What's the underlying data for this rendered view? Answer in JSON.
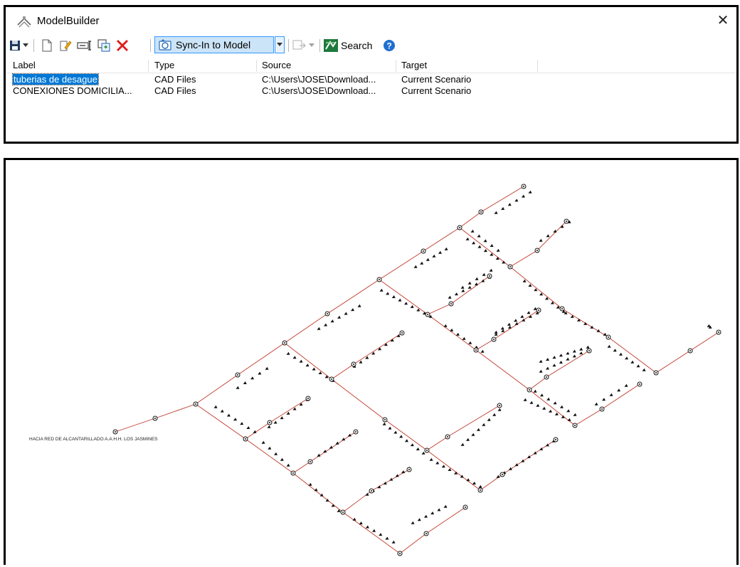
{
  "window": {
    "title": "ModelBuilder",
    "close_glyph": "✕"
  },
  "toolbar": {
    "sync_label": "Sync-In to Model",
    "search_label": "Search",
    "icons": [
      "save-icon",
      "dropdown-icon",
      "new-icon",
      "edit-icon",
      "rename-icon",
      "duplicate-icon",
      "delete-icon",
      "sync-icon",
      "build-icon",
      "search-icon",
      "help-icon"
    ]
  },
  "table": {
    "columns": [
      "Label",
      "Type",
      "Source",
      "Target"
    ],
    "rows": [
      {
        "label": "tuberias de desague",
        "type": "CAD Files",
        "source": "C:\\Users\\JOSE\\Download...",
        "target": "Current Scenario",
        "selected": true
      },
      {
        "label": "CONEXIONES DOMICILIA...",
        "type": "CAD Files",
        "source": "C:\\Users\\JOSE\\Download...",
        "target": "Current Scenario",
        "selected": false
      }
    ]
  },
  "drawing": {
    "annotation": "HACIA RED DE ALCANTARILLADO A.A.H.H. LOS JASMINES",
    "pipe_color": "#c0392b"
  }
}
